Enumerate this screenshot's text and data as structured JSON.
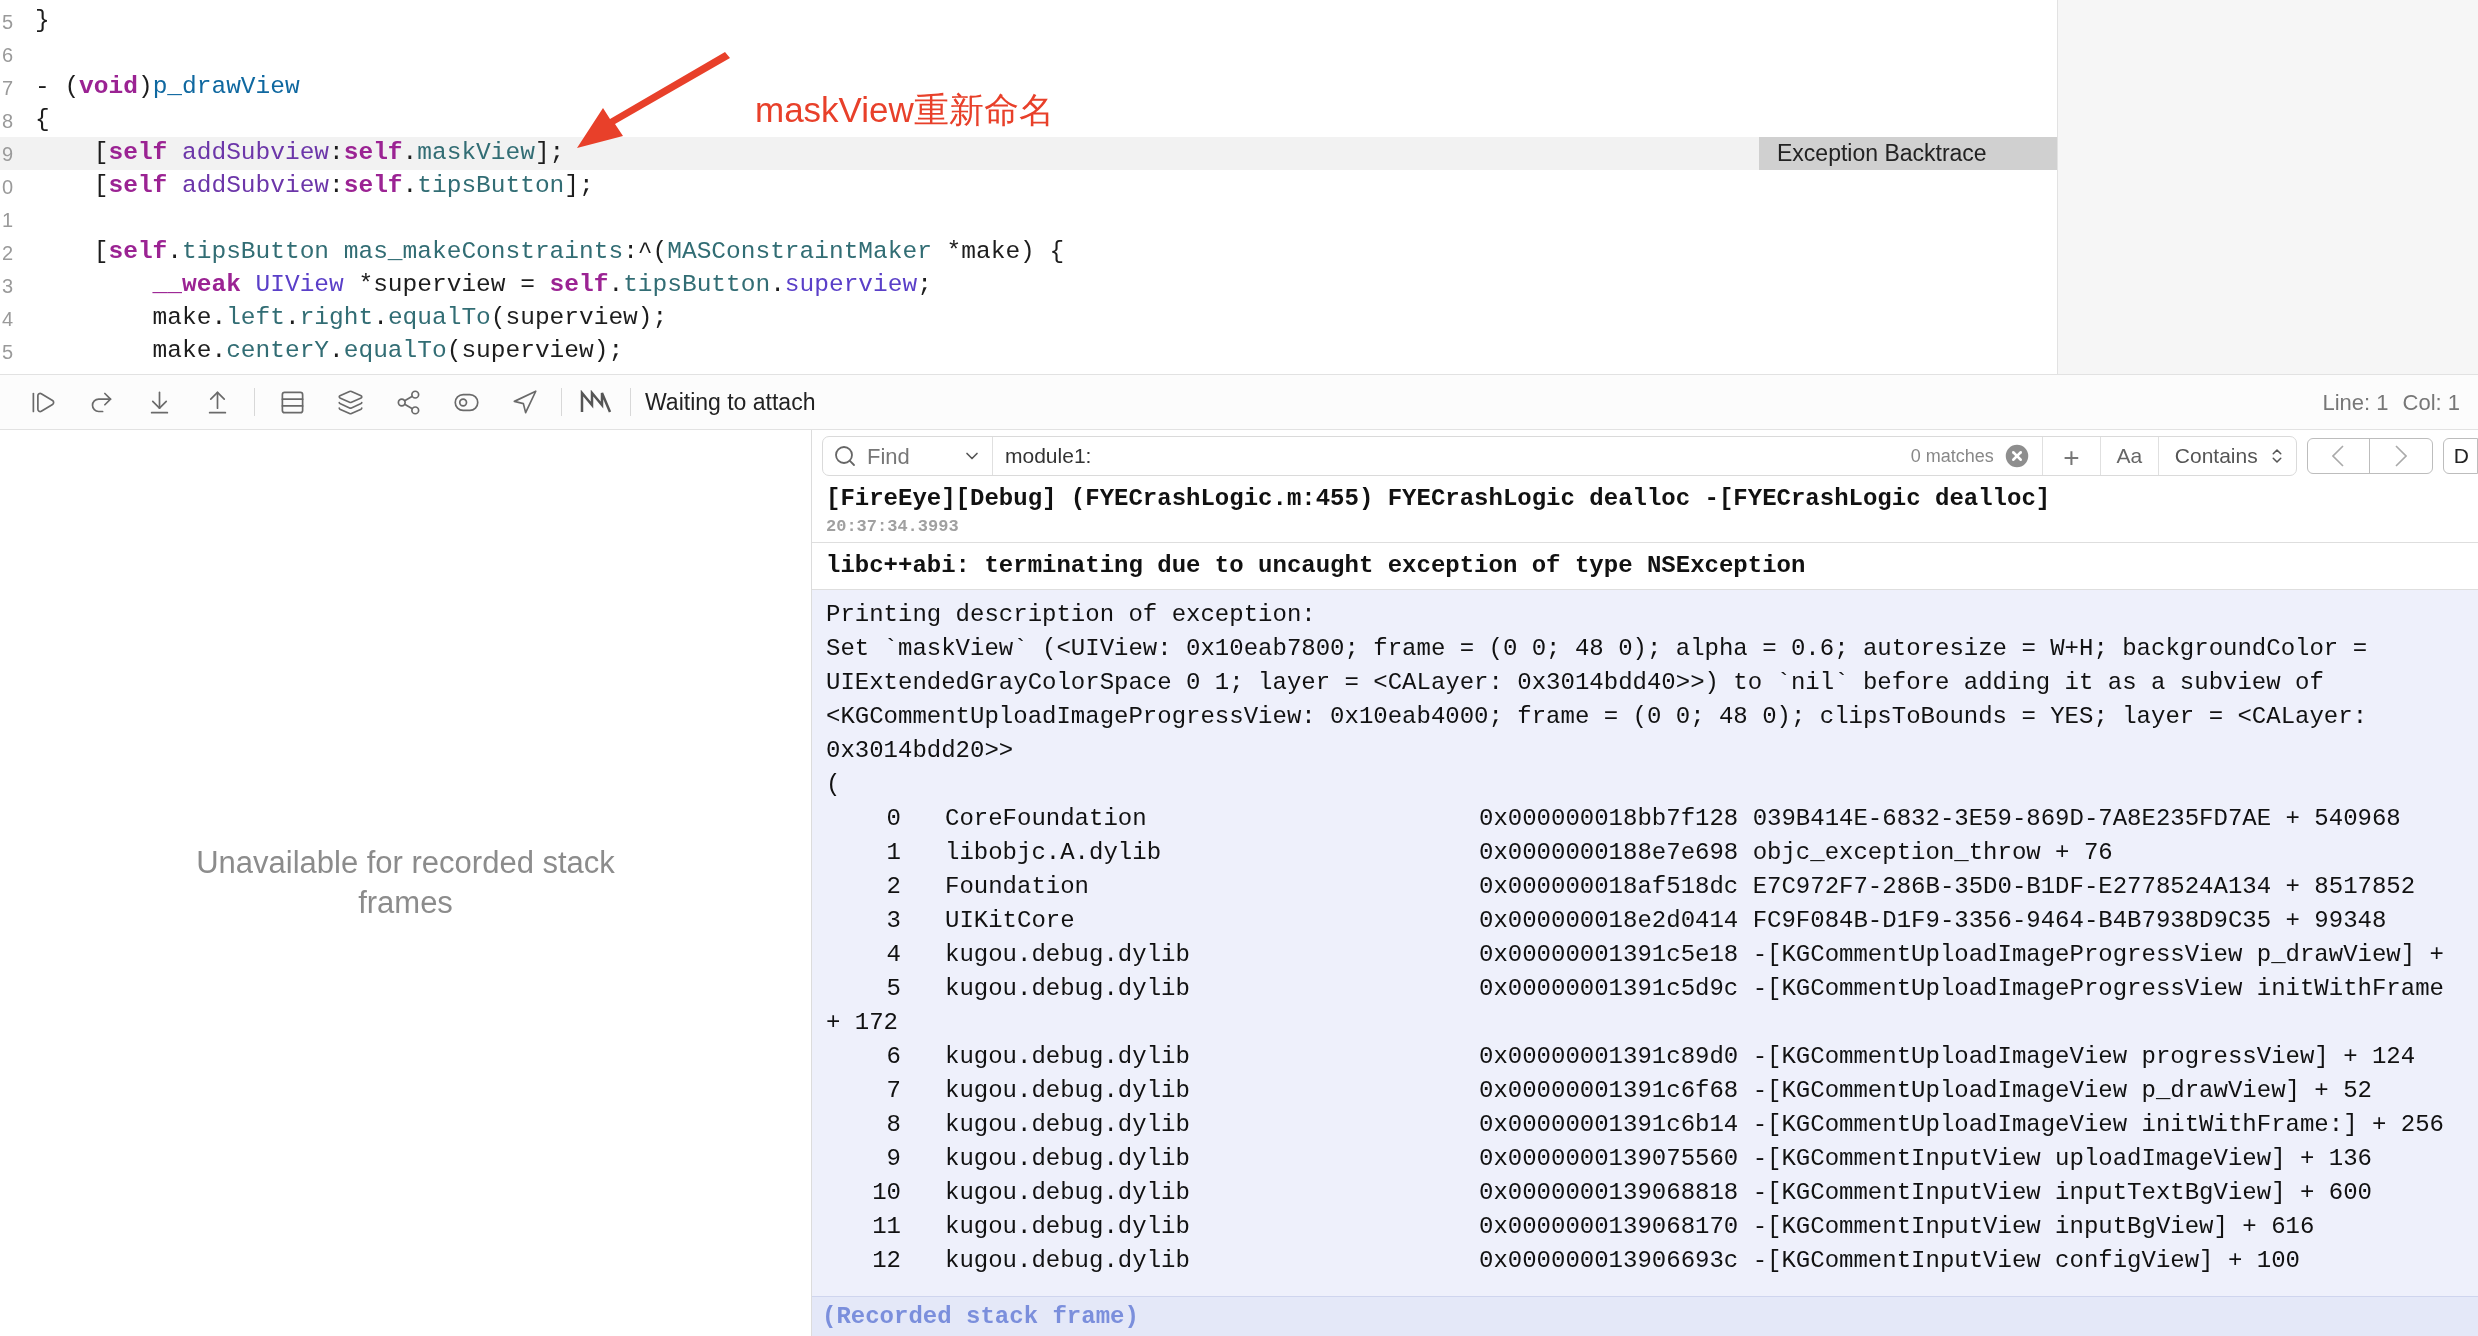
{
  "editor": {
    "lines": [
      {
        "number": "5",
        "current": false,
        "tokens": [
          {
            "kind": "plain",
            "text": "}"
          }
        ]
      },
      {
        "number": "6",
        "current": false
      },
      {
        "number": "7",
        "current": false,
        "tokens": [
          {
            "kind": "plain",
            "text": "- ("
          },
          {
            "kind": "keyword",
            "text": "void"
          },
          {
            "kind": "plain",
            "text": ")"
          },
          {
            "kind": "function",
            "text": "p_drawView"
          }
        ]
      },
      {
        "number": "8",
        "current": false,
        "tokens": [
          {
            "kind": "plain",
            "text": "{"
          }
        ]
      },
      {
        "number": "9",
        "current": true,
        "tokens": [
          {
            "kind": "plain",
            "text": "    ["
          },
          {
            "kind": "keyword",
            "text": "self"
          },
          {
            "kind": "method",
            "text": " addSubview"
          },
          {
            "kind": "plain",
            "text": ":"
          },
          {
            "kind": "keyword",
            "text": "self"
          },
          {
            "kind": "plain",
            "text": "."
          },
          {
            "kind": "property",
            "text": "maskView"
          },
          {
            "kind": "plain",
            "text": "];"
          }
        ]
      },
      {
        "number": "0",
        "current": false,
        "tokens": [
          {
            "kind": "plain",
            "text": "    ["
          },
          {
            "kind": "keyword",
            "text": "self"
          },
          {
            "kind": "method",
            "text": " addSubview"
          },
          {
            "kind": "plain",
            "text": ":"
          },
          {
            "kind": "keyword",
            "text": "self"
          },
          {
            "kind": "plain",
            "text": "."
          },
          {
            "kind": "property",
            "text": "tipsButton"
          },
          {
            "kind": "plain",
            "text": "];"
          }
        ]
      },
      {
        "number": "1",
        "current": false
      },
      {
        "number": "2",
        "current": false,
        "tokens": [
          {
            "kind": "plain",
            "text": "    ["
          },
          {
            "kind": "keyword",
            "text": "self"
          },
          {
            "kind": "plain",
            "text": "."
          },
          {
            "kind": "property",
            "text": "tipsButton"
          },
          {
            "kind": "property",
            "text": " mas_makeConstraints"
          },
          {
            "kind": "plain",
            "text": ":^("
          },
          {
            "kind": "property",
            "text": "MASConstraintMaker"
          },
          {
            "kind": "plain",
            "text": " *make) {"
          }
        ]
      },
      {
        "number": "3",
        "current": false,
        "tokens": [
          {
            "kind": "keyword",
            "text": "        __weak"
          },
          {
            "kind": "type",
            "text": " UIView"
          },
          {
            "kind": "plain",
            "text": " *superview = "
          },
          {
            "kind": "keyword",
            "text": "self"
          },
          {
            "kind": "plain",
            "text": "."
          },
          {
            "kind": "property",
            "text": "tipsButton"
          },
          {
            "kind": "plain",
            "text": "."
          },
          {
            "kind": "type",
            "text": "superview"
          },
          {
            "kind": "plain",
            "text": ";"
          }
        ]
      },
      {
        "number": "4",
        "current": false,
        "tokens": [
          {
            "kind": "plain",
            "text": "        make."
          },
          {
            "kind": "property",
            "text": "left"
          },
          {
            "kind": "plain",
            "text": "."
          },
          {
            "kind": "property",
            "text": "right"
          },
          {
            "kind": "plain",
            "text": "."
          },
          {
            "kind": "property",
            "text": "equalTo"
          },
          {
            "kind": "plain",
            "text": "(superview);"
          }
        ]
      },
      {
        "number": "5",
        "current": false,
        "tokens": [
          {
            "kind": "plain",
            "text": "        make."
          },
          {
            "kind": "property",
            "text": "centerY"
          },
          {
            "kind": "plain",
            "text": "."
          },
          {
            "kind": "property",
            "text": "equalTo"
          },
          {
            "kind": "plain",
            "text": "(superview);"
          }
        ]
      }
    ],
    "badge": "Exception Backtrace",
    "annotation": {
      "text": "maskView重新命名"
    }
  },
  "debug_bar": {
    "status": "Waiting to attach",
    "line": "Line: 1",
    "col": "Col: 1"
  },
  "variables_panel": {
    "message": "Unavailable for recorded stack frames"
  },
  "console": {
    "find": {
      "mode": "Find",
      "value": "module1:",
      "matches": "0 matches",
      "plus": "+",
      "case": "Aa",
      "match_type": "Contains",
      "partial_button": "D"
    },
    "entries": [
      {
        "text": "[FireEye][Debug] (FYECrashLogic.m:455) FYECrashLogic dealloc -[FYECrashLogic dealloc]",
        "time": "20:37:34.3993"
      },
      {
        "text": "libc++abi: terminating due to uncaught exception of type NSException"
      }
    ],
    "description": [
      "Printing description of exception:",
      "Set `maskView` (<UIView: 0x10eab7800; frame = (0 0; 48 0); alpha = 0.6; autoresize = W+H; backgroundColor =",
      "UIExtendedGrayColorSpace 0 1; layer = <CALayer: 0x3014bdd40>>) to `nil` before adding it as a subview of",
      "<KGCommentUploadImageProgressView: 0x10eab4000; frame = (0 0; 48 0); clipsToBounds = YES; layer = <CALayer:",
      "0x3014bdd20>>",
      "("
    ],
    "frames": [
      {
        "index": "0",
        "library": "CoreFoundation",
        "symbol": "0x000000018bb7f128 039B414E-6832-3E59-869D-7A8E235FD7AE + 540968"
      },
      {
        "index": "1",
        "library": "libobjc.A.dylib",
        "symbol": "0x0000000188e7e698 objc_exception_throw + 76"
      },
      {
        "index": "2",
        "library": "Foundation",
        "symbol": "0x000000018af518dc E7C972F7-286B-35D0-B1DF-E2778524A134 + 8517852"
      },
      {
        "index": "3",
        "library": "UIKitCore",
        "symbol": "0x000000018e2d0414 FC9F084B-D1F9-3356-9464-B4B7938D9C35 + 99348"
      },
      {
        "index": "4",
        "library": "kugou.debug.dylib",
        "symbol": "0x00000001391c5e18 -[KGCommentUploadImageProgressView p_drawView] +"
      },
      {
        "index": "5",
        "library": "kugou.debug.dylib",
        "symbol": "0x00000001391c5d9c -[KGCommentUploadImageProgressView initWithFrame",
        "continuation": "+ 172"
      },
      {
        "index": "6",
        "library": "kugou.debug.dylib",
        "symbol": "0x00000001391c89d0 -[KGCommentUploadImageView progressView] + 124"
      },
      {
        "index": "7",
        "library": "kugou.debug.dylib",
        "symbol": "0x00000001391c6f68 -[KGCommentUploadImageView p_drawView] + 52"
      },
      {
        "index": "8",
        "library": "kugou.debug.dylib",
        "symbol": "0x00000001391c6b14 -[KGCommentUploadImageView initWithFrame:] + 256"
      },
      {
        "index": "9",
        "library": "kugou.debug.dylib",
        "symbol": "0x0000000139075560 -[KGCommentInputView uploadImageView] + 136"
      },
      {
        "index": "10",
        "library": "kugou.debug.dylib",
        "symbol": "0x0000000139068818 -[KGCommentInputView inputTextBgView] + 600"
      },
      {
        "index": "11",
        "library": "kugou.debug.dylib",
        "symbol": "0x0000000139068170 -[KGCommentInputView inputBgView] + 616"
      },
      {
        "index": "12",
        "library": "kugou.debug.dylib",
        "symbol": "0x000000013906693c -[KGCommentInputView configView] + 100"
      }
    ],
    "footer": "(Recorded stack frame)"
  }
}
